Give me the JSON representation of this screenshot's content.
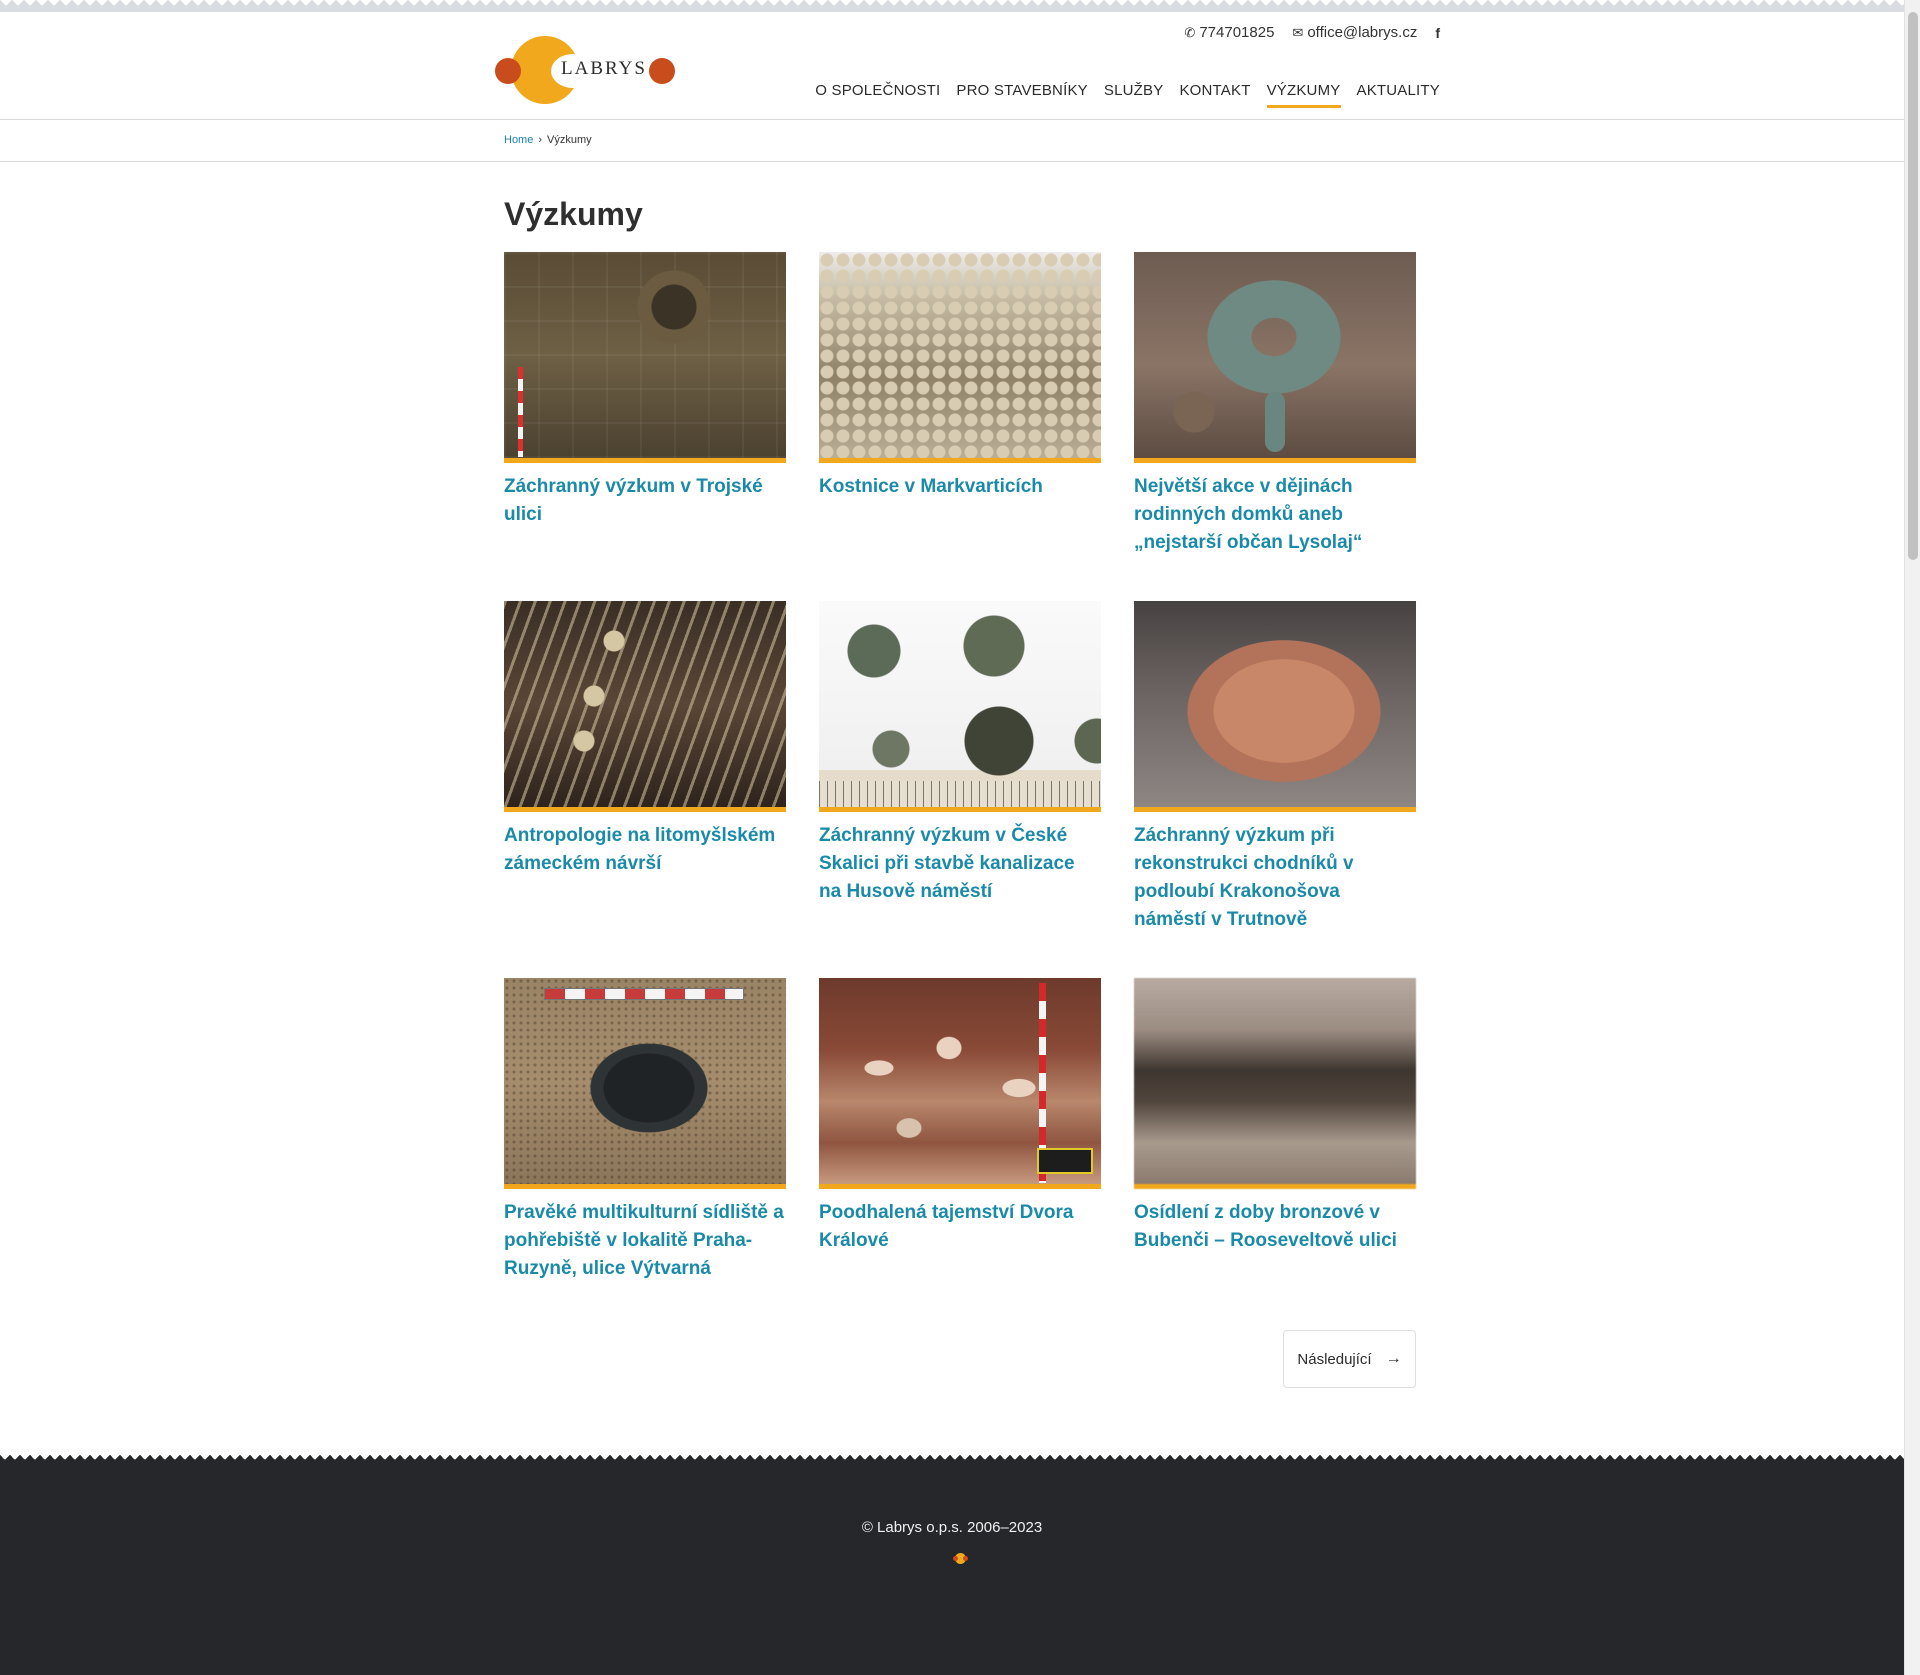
{
  "brand": {
    "name": "LABRYS",
    "accent_color": "#f2a81d",
    "secondary_color": "#c94d1c",
    "link_color": "#1a8aa8"
  },
  "contacts": {
    "phone": "774701825",
    "phone_icon": "phone-icon",
    "email": "office@labrys.cz",
    "email_icon": "envelope-icon",
    "facebook_label": "f"
  },
  "nav": {
    "items": [
      {
        "label": "O SPOLEČNOSTI"
      },
      {
        "label": "PRO STAVEBNÍKY"
      },
      {
        "label": "SLUŽBY"
      },
      {
        "label": "KONTAKT"
      },
      {
        "label": "VÝZKUMY",
        "active": true
      },
      {
        "label": "AKTUALITY"
      }
    ]
  },
  "breadcrumb": {
    "home": "Home",
    "separator": "›",
    "current": "Výzkumy"
  },
  "page": {
    "title": "Výzkumy"
  },
  "articles": [
    {
      "title": "Záchranný výzkum v Trojské ulici"
    },
    {
      "title": "Kostnice v Markvarticích"
    },
    {
      "title": "Největší akce v dějinách rodinných domků aneb „nejstarší občan Lysolaj“"
    },
    {
      "title": "Antropologie na litomyšlském zámeckém návrší"
    },
    {
      "title": "Záchranný výzkum v České Skalici při stavbě kanalizace na Husově náměstí"
    },
    {
      "title": "Záchranný výzkum při rekonstrukci chodníků v podloubí Krakonošova náměstí v Trutnově"
    },
    {
      "title": "Pravěké multikulturní sídliště a pohřebiště v lokalitě Praha-Ruzyně, ulice Výtvarná"
    },
    {
      "title": "Poodhalená tajemství Dvora Králové"
    },
    {
      "title": "Osídlení z doby bronzové v Bubenči – Rooseveltově ulici"
    }
  ],
  "pagination": {
    "next_label": "Následující",
    "next_icon": "arrow-right-icon"
  },
  "footer": {
    "copyright": "© Labrys o.p.s. 2006–2023"
  }
}
